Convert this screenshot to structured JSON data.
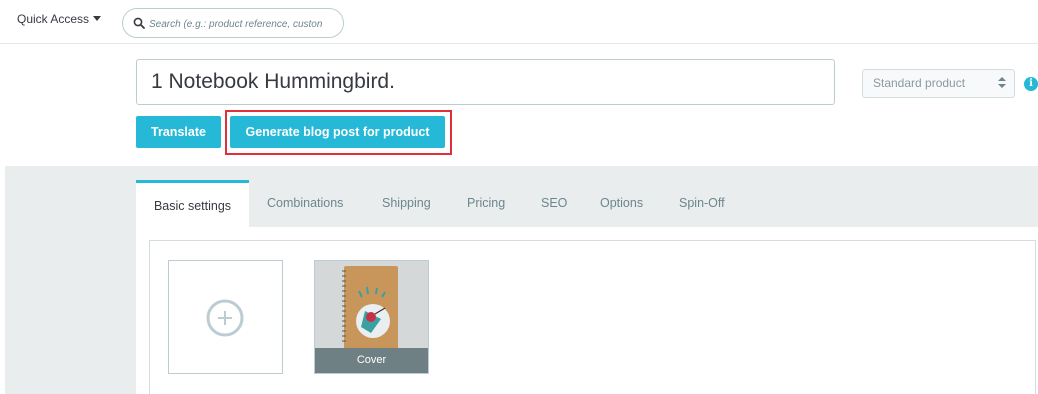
{
  "header": {
    "quick_access_label": "Quick Access",
    "search_placeholder": "Search (e.g.: product reference, custon"
  },
  "product": {
    "name": "1 Notebook Hummingbird.",
    "type_selected": "Standard product"
  },
  "actions": {
    "translate_label": "Translate",
    "generate_label": "Generate blog post for product"
  },
  "tabs": [
    {
      "label": "Basic settings",
      "active": true
    },
    {
      "label": "Combinations",
      "active": false
    },
    {
      "label": "Shipping",
      "active": false
    },
    {
      "label": "Pricing",
      "active": false
    },
    {
      "label": "SEO",
      "active": false
    },
    {
      "label": "Options",
      "active": false
    },
    {
      "label": "Spin-Off",
      "active": false
    }
  ],
  "images": {
    "cover_label": "Cover"
  },
  "colors": {
    "accent": "#25b9d7",
    "highlight": "#e0313a",
    "notebook": "#c8955a"
  }
}
